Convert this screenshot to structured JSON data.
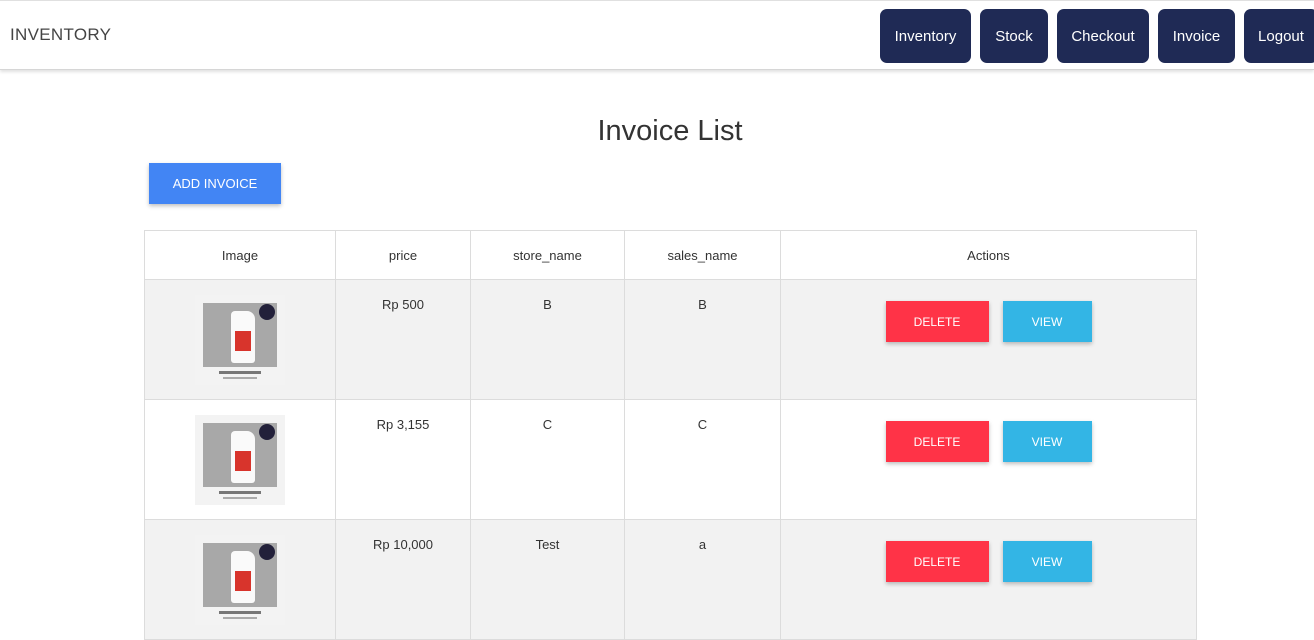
{
  "navbar": {
    "brand": "INVENTORY",
    "links": [
      {
        "label": "Inventory",
        "key": "inventory"
      },
      {
        "label": "Stock",
        "key": "stock"
      },
      {
        "label": "Checkout",
        "key": "checkout"
      },
      {
        "label": "Invoice",
        "key": "invoice"
      },
      {
        "label": "Logout",
        "key": "logout"
      }
    ]
  },
  "page": {
    "title": "Invoice List",
    "add_button": "ADD INVOICE"
  },
  "table": {
    "headers": [
      "Image",
      "price",
      "store_name",
      "sales_name",
      "Actions"
    ],
    "rows": [
      {
        "price": "Rp 500",
        "store_name": "B",
        "sales_name": "B"
      },
      {
        "price": "Rp 3,155",
        "store_name": "C",
        "sales_name": "C"
      },
      {
        "price": "Rp 10,000",
        "store_name": "Test",
        "sales_name": "a"
      }
    ],
    "delete_label": "DELETE",
    "view_label": "VIEW"
  },
  "colors": {
    "nav_button": "#1f2a55",
    "add_button": "#4285f4",
    "delete_button": "#ff3347",
    "view_button": "#33b5e5"
  }
}
